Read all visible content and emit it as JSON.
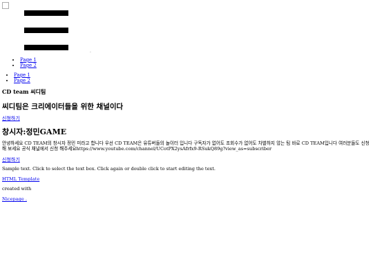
{
  "nav": {
    "menu_items": [
      "Page 1",
      "Page 2"
    ],
    "menu_items_secondary": [
      "Page 1",
      "Page 2"
    ],
    "hamburger_dot": "."
  },
  "hero": {
    "brand": "CD team 씨디팀",
    "subtitle": "씨디팀은 크리에이터들을 위한 채널이다",
    "apply_button": "신청하기"
  },
  "founder": {
    "heading": "창시자:정민GAME",
    "intro": "안녕하세요 CD TEAM의 창시자 정민 미라고 합니다 우선 CD TEAM은 유튜버들의 놀이터 입니다 구독자가 없어도 조회수가 없어도 차별하지 않는 팀 바로 CD TEAM입니다 여러분들도 신청해 보세요 공식 채널에서 신청 해주세요https://www.youtube.com/channel/UCotPX2ysAfrfx9-RSukQ89g?view_as=subscriber",
    "apply_button": "신청하기"
  },
  "footer": {
    "sample_text": "Sample text. Click to select the text box. Click again or double click to start editing the text.",
    "template_link": "HTML Template",
    "created_with": "created with",
    "nicepage_link": "Nicepage ."
  }
}
